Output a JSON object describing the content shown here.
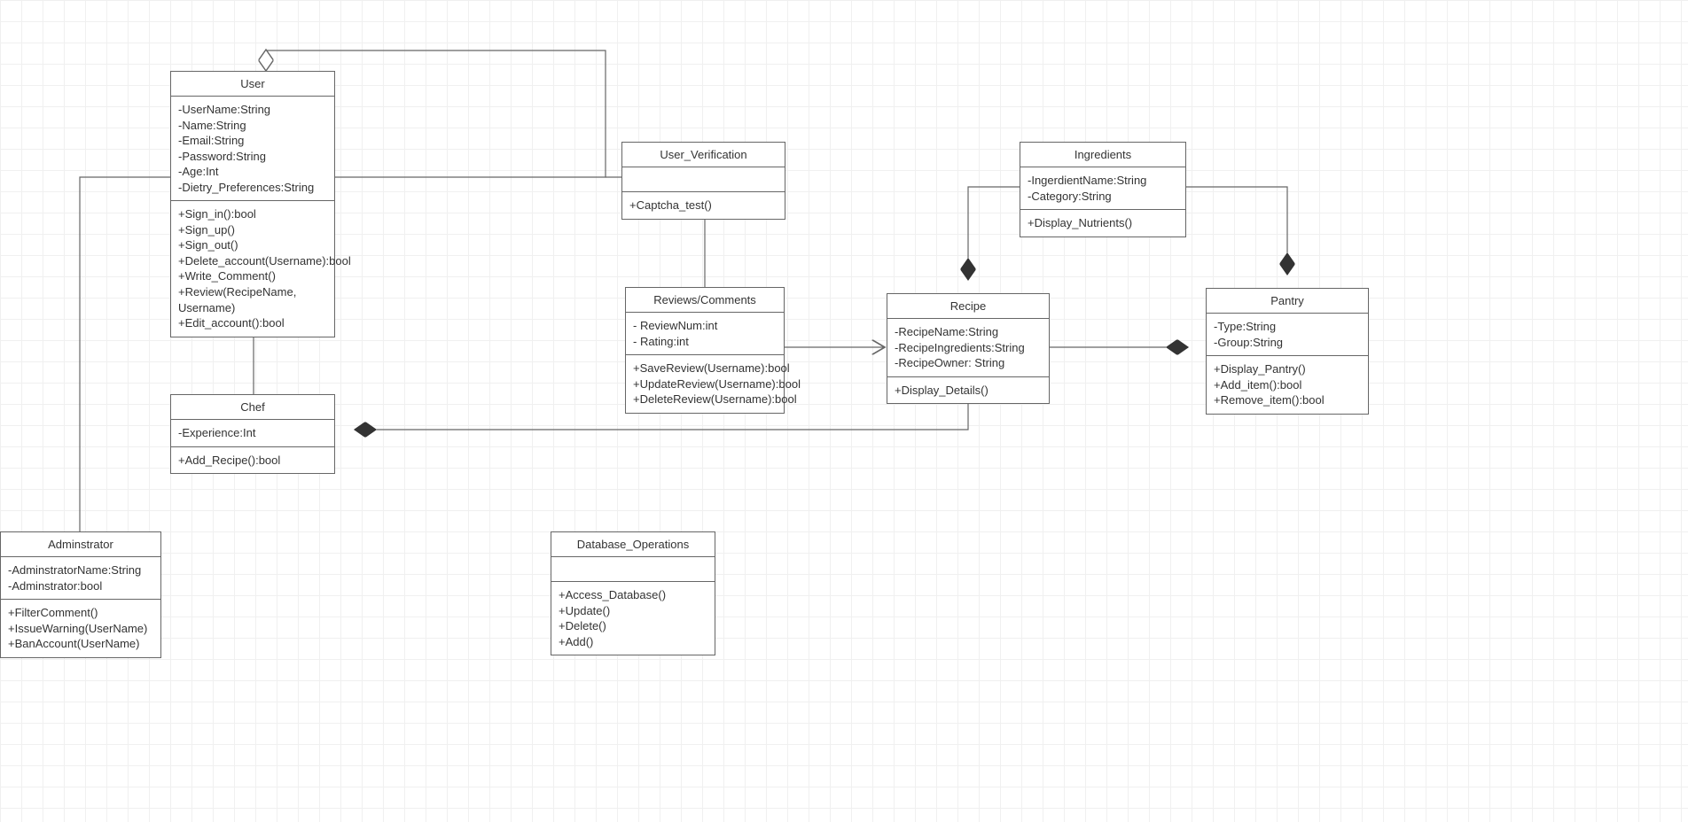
{
  "classes": {
    "user": {
      "title": "User",
      "attrs": [
        "-UserName:String",
        "-Name:String",
        "-Email:String",
        "-Password:String",
        "-Age:Int",
        "-Dietry_Preferences:String"
      ],
      "ops": [
        "+Sign_in():bool",
        "+Sign_up()",
        "+Sign_out()",
        "+Delete_account(Username):bool",
        "+Write_Comment()",
        "+Review(RecipeName, Username)",
        "+Edit_account():bool"
      ]
    },
    "user_verification": {
      "title": "User_Verification",
      "attrs": [],
      "ops": [
        "+Captcha_test()"
      ]
    },
    "ingredients": {
      "title": "Ingredients",
      "attrs": [
        "-IngerdientName:String",
        "-Category:String"
      ],
      "ops": [
        "+Display_Nutrients()"
      ]
    },
    "reviews": {
      "title": "Reviews/Comments",
      "attrs": [
        "- ReviewNum:int",
        "- Rating:int"
      ],
      "ops": [
        "+SaveReview(Username):bool",
        "+UpdateReview(Username):bool",
        "+DeleteReview(Username):bool"
      ]
    },
    "recipe": {
      "title": "Recipe",
      "attrs": [
        "-RecipeName:String",
        "-RecipeIngredients:String",
        "-RecipeOwner: String"
      ],
      "ops": [
        "+Display_Details()"
      ]
    },
    "pantry": {
      "title": "Pantry",
      "attrs": [
        "-Type:String",
        "-Group:String"
      ],
      "ops": [
        "+Display_Pantry()",
        "+Add_item():bool",
        "+Remove_item():bool"
      ]
    },
    "chef": {
      "title": "Chef",
      "attrs": [
        "-Experience:Int"
      ],
      "ops": [
        "+Add_Recipe():bool"
      ]
    },
    "administrator": {
      "title": "Adminstrator",
      "attrs": [
        "-AdminstratorName:String",
        "-Adminstrator:bool"
      ],
      "ops": [
        "+FilterComment()",
        "+IssueWarning(UserName)",
        "+BanAccount(UserName)"
      ]
    },
    "database_ops": {
      "title": "Database_Operations",
      "attrs": [],
      "ops": [
        "+Access_Database()",
        "+Update()",
        "+Delete()",
        "+Add()"
      ]
    }
  }
}
